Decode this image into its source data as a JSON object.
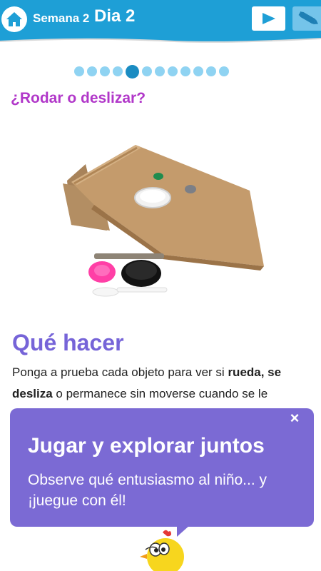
{
  "header": {
    "home_icon": "home-icon",
    "week": "Semana 2",
    "day": "Dia 2",
    "play_icon": "play-icon",
    "pen_icon": "pen-icon",
    "bar_color": "#1e9fd6"
  },
  "pagination": {
    "total": 12,
    "active": 5
  },
  "activity": {
    "title": "¿Rodar o deslizar?"
  },
  "what_to_do": {
    "heading": "Qué hacer",
    "text_1": "Ponga a prueba cada objeto para ver si ",
    "bold_1": "rueda, se",
    "text_2": " ",
    "bold_2": "desliza",
    "text_3": " o permanece sin moverse cuando se le"
  },
  "tip": {
    "close": "×",
    "title": "Jugar y explorar juntos",
    "body": "Observe qué entusiasmo al niño... y ¡juegue con él!",
    "color": "#7b6ad4"
  }
}
